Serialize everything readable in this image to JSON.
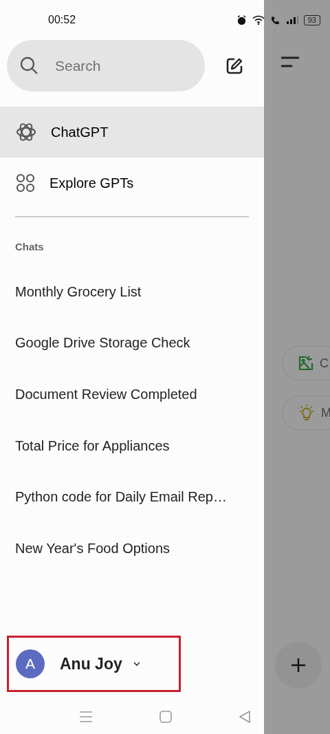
{
  "status_bar": {
    "time": "00:52",
    "battery": "93"
  },
  "search": {
    "placeholder": "Search"
  },
  "nav_items": [
    {
      "label": "ChatGPT",
      "selected": true,
      "kind": "logo"
    },
    {
      "label": "Explore GPTs",
      "selected": false,
      "kind": "grid"
    }
  ],
  "section_title": "Chats",
  "chats": [
    "Monthly Grocery List",
    "Google Drive Storage Check",
    "Document Review Completed",
    "Total Price for Appliances",
    "Python code for Daily Email Rep…",
    "New Year's Food Options"
  ],
  "account": {
    "initial": "A",
    "name": "Anu Joy",
    "highlighted": true
  },
  "background": {
    "chips": [
      {
        "text": "C",
        "kind": "image"
      },
      {
        "text": "M",
        "kind": "idea"
      }
    ]
  }
}
